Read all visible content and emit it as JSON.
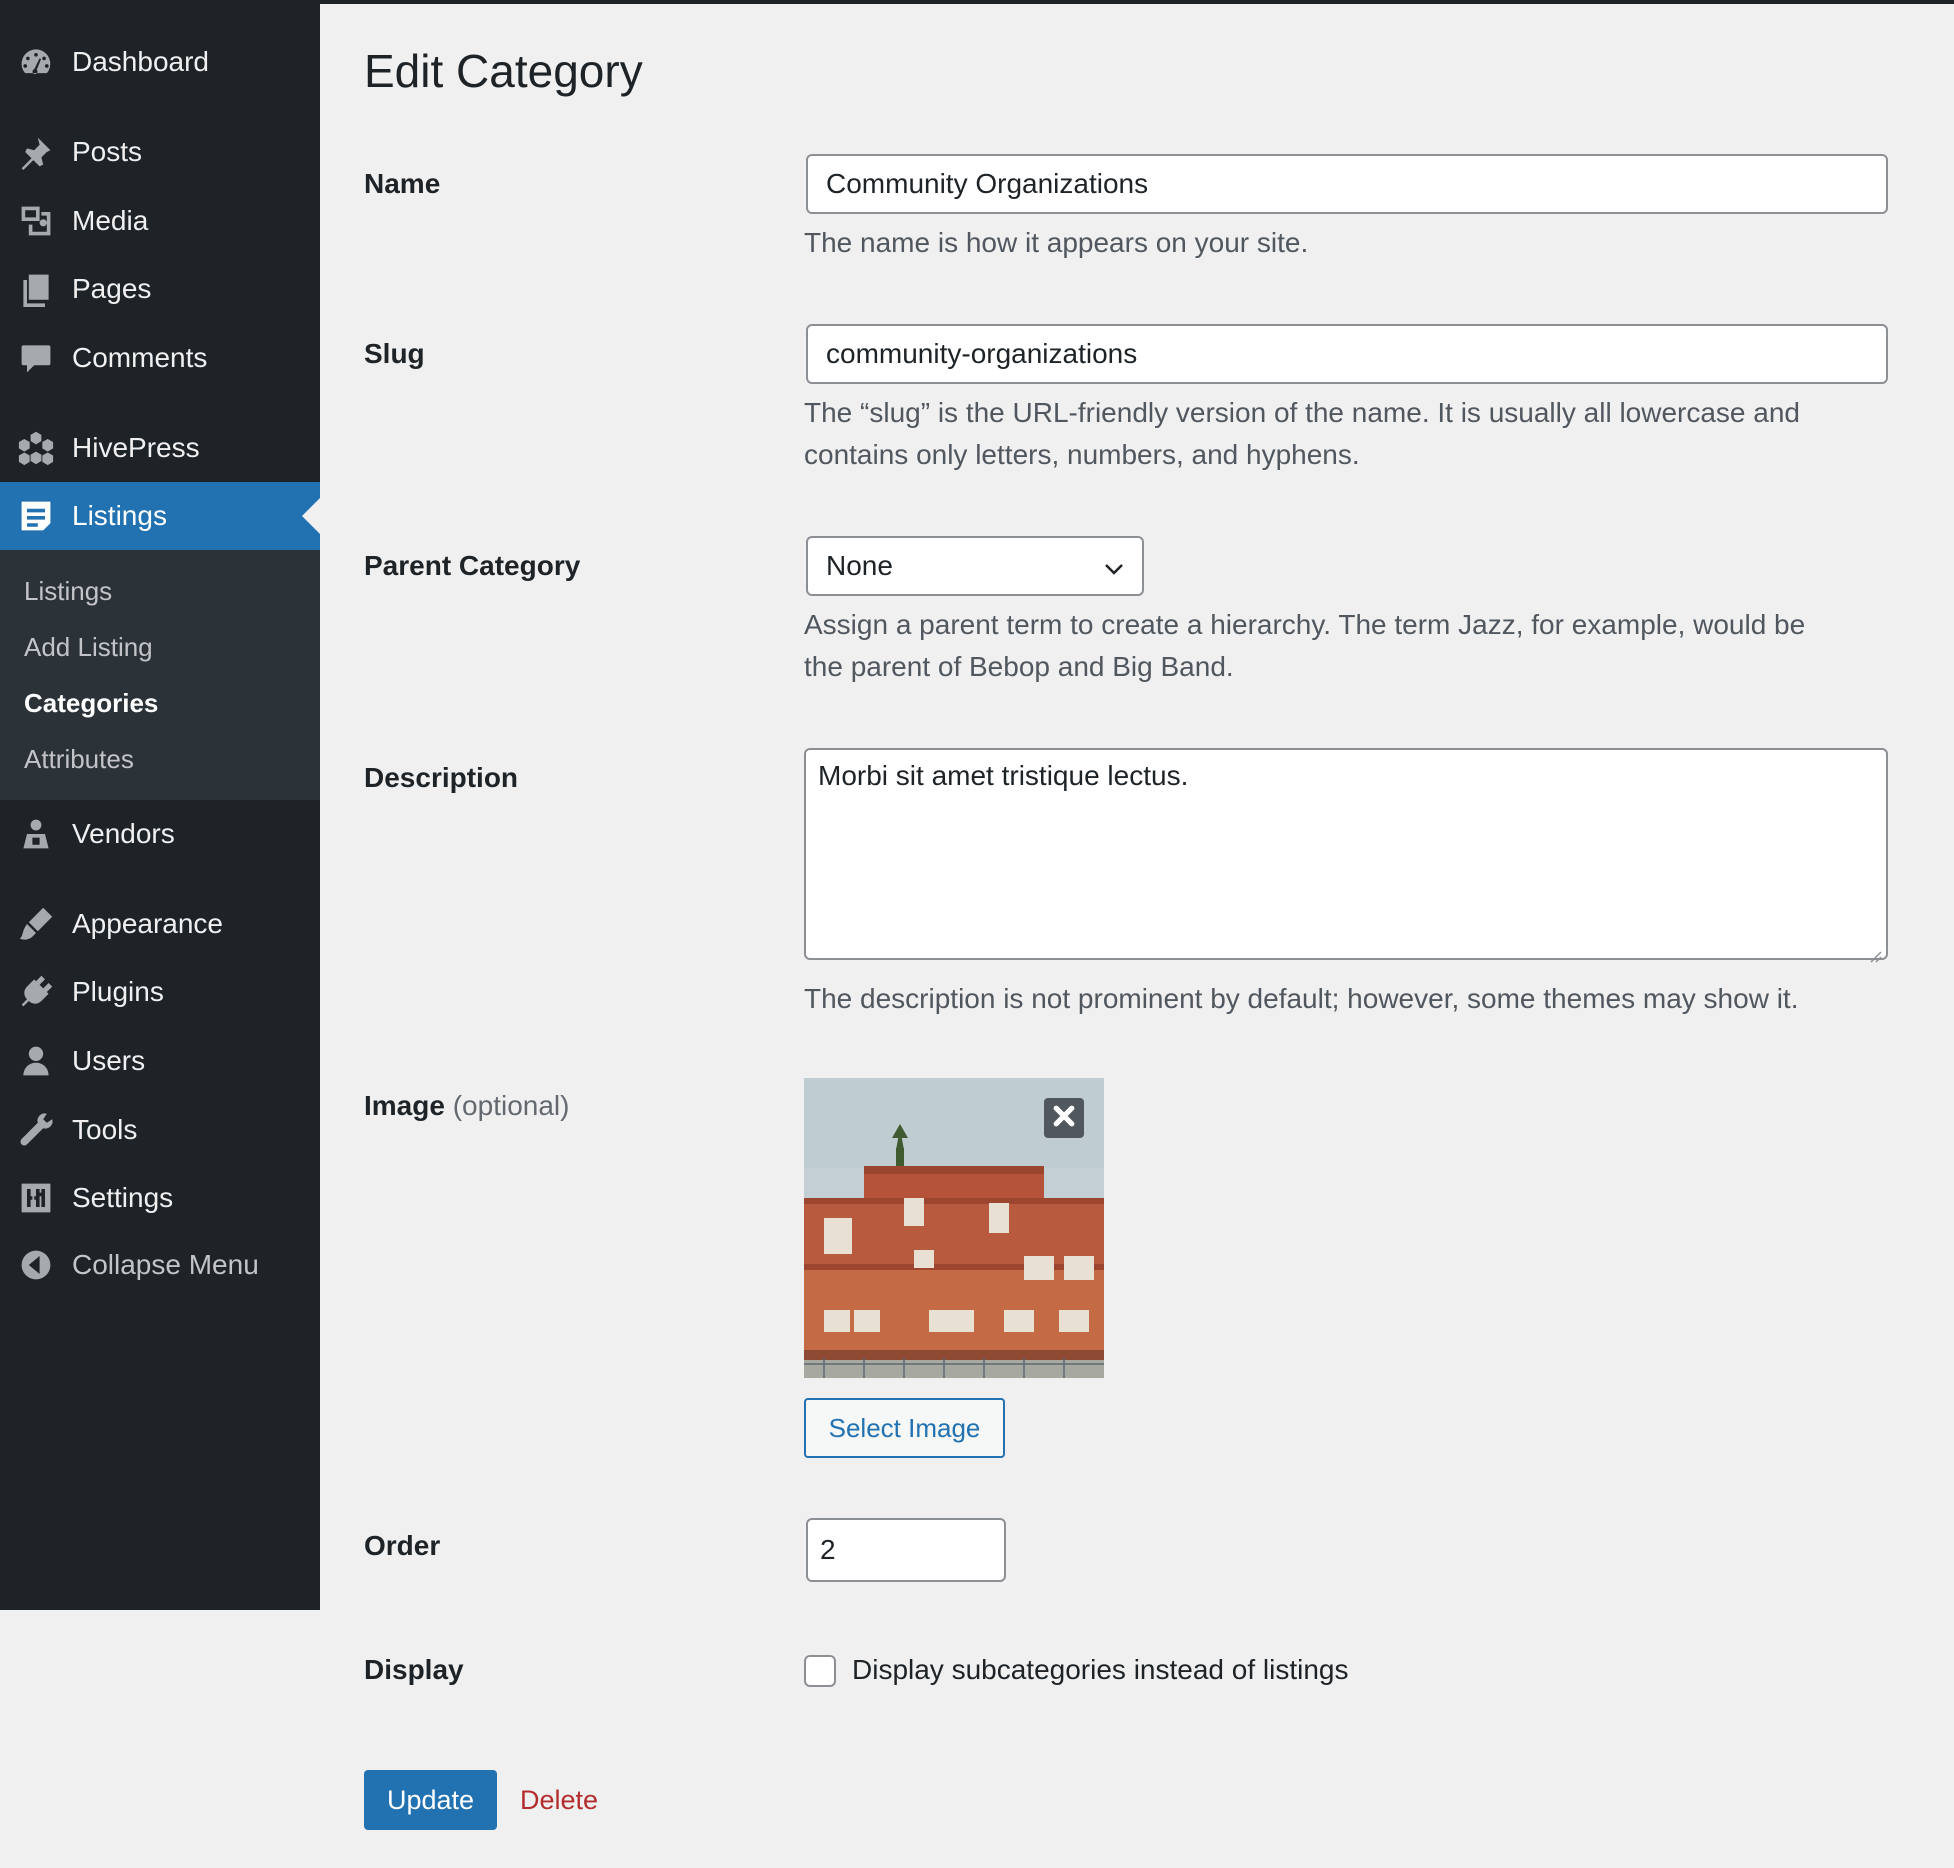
{
  "sidebar": {
    "menu": [
      {
        "label": "Dashboard",
        "icon": "dashboard-icon"
      },
      {
        "label": "Posts",
        "icon": "pin-icon"
      },
      {
        "label": "Media",
        "icon": "media-icon"
      },
      {
        "label": "Pages",
        "icon": "pages-icon"
      },
      {
        "label": "Comments",
        "icon": "comment-icon"
      },
      {
        "label": "HivePress",
        "icon": "hivepress-icon"
      },
      {
        "label": "Listings",
        "icon": "listings-icon"
      },
      {
        "label": "Vendors",
        "icon": "vendor-icon"
      },
      {
        "label": "Appearance",
        "icon": "brush-icon"
      },
      {
        "label": "Plugins",
        "icon": "plugin-icon"
      },
      {
        "label": "Users",
        "icon": "user-icon"
      },
      {
        "label": "Tools",
        "icon": "wrench-icon"
      },
      {
        "label": "Settings",
        "icon": "settings-icon"
      },
      {
        "label": "Collapse Menu",
        "icon": "collapse-icon"
      }
    ],
    "submenu": [
      "Listings",
      "Add Listing",
      "Categories",
      "Attributes"
    ],
    "active_item": "Listings",
    "current_submenu": "Categories"
  },
  "page": {
    "title": "Edit Category"
  },
  "form": {
    "name": {
      "label": "Name",
      "value": "Community Organizations",
      "help": "The name is how it appears on your site."
    },
    "slug": {
      "label": "Slug",
      "value": "community-organizations",
      "help_line1": "The “slug” is the URL-friendly version of the name. It is usually all lowercase and",
      "help_line2": "contains only letters, numbers, and hyphens."
    },
    "parent": {
      "label": "Parent Category",
      "selected": "None",
      "help_line1": "Assign a parent term to create a hierarchy. The term Jazz, for example, would be",
      "help_line2": "the parent of Bebop and Big Band."
    },
    "description": {
      "label": "Description",
      "value": "Morbi sit amet tristique lectus.",
      "help": "The description is not prominent by default; however, some themes may show it."
    },
    "image": {
      "label": "Image",
      "optional": "(optional)",
      "select_button": "Select Image"
    },
    "order": {
      "label": "Order",
      "value": "2"
    },
    "display": {
      "label": "Display",
      "checkbox_label": "Display subcategories instead of listings",
      "checked": false
    }
  },
  "actions": {
    "update": "Update",
    "delete": "Delete"
  },
  "colors": {
    "sidebar_bg": "#1d2327",
    "submenu_bg": "#2c3338",
    "accent": "#2271b1",
    "danger": "#b32d2e",
    "page_bg": "#f0f0f1"
  }
}
